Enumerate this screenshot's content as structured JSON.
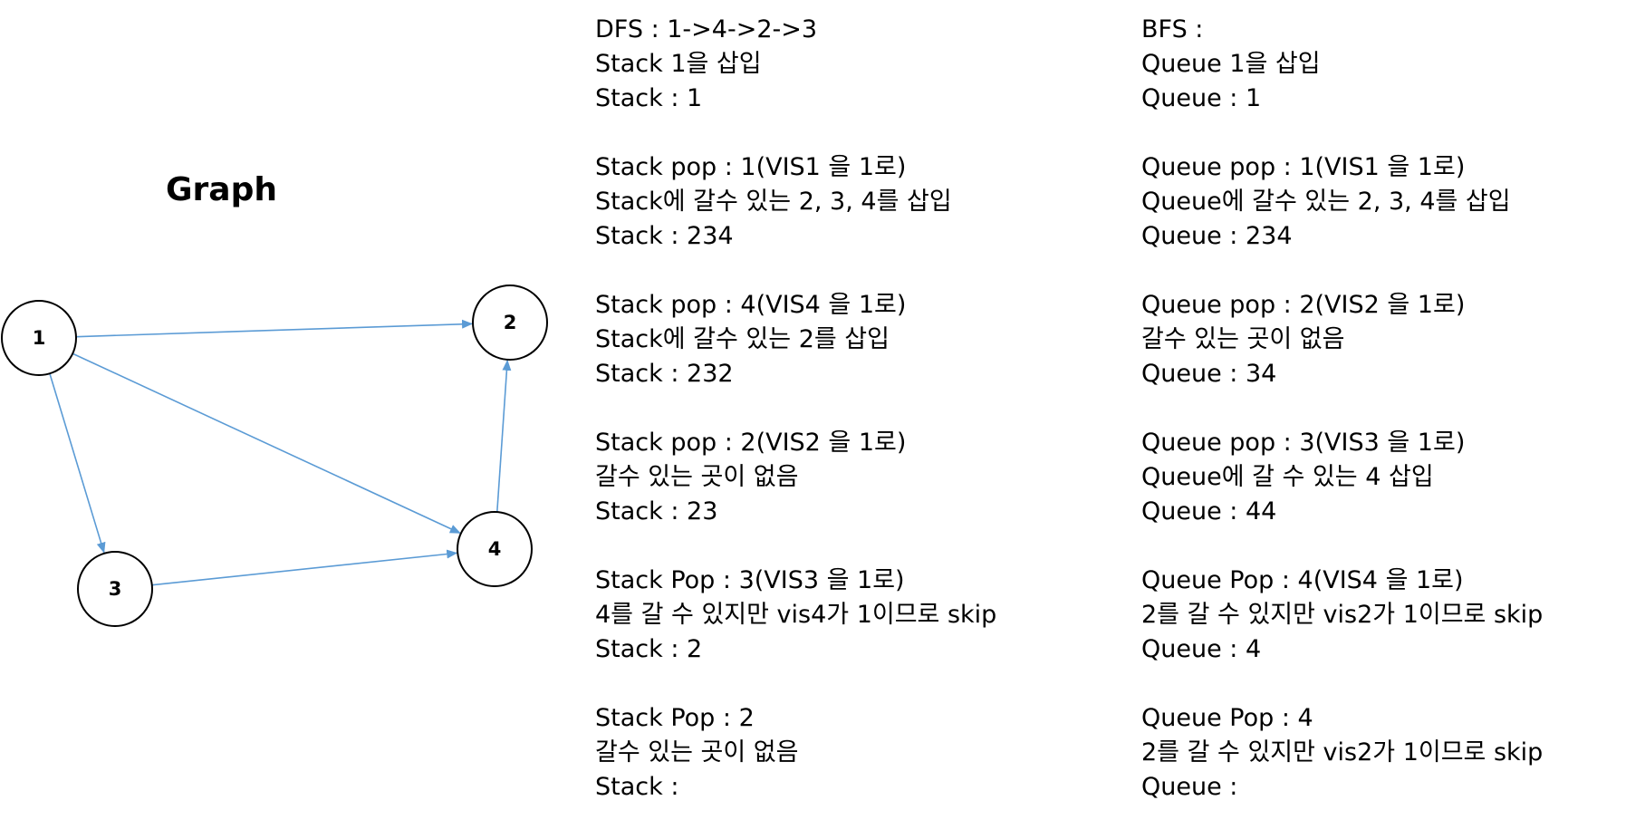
{
  "graph": {
    "title": "Graph",
    "edge_color": "#5b9bd5",
    "nodes": [
      "1",
      "2",
      "3",
      "4"
    ],
    "edges": [
      {
        "from": "1",
        "to": "2"
      },
      {
        "from": "1",
        "to": "3"
      },
      {
        "from": "1",
        "to": "4"
      },
      {
        "from": "3",
        "to": "4"
      },
      {
        "from": "4",
        "to": "2"
      }
    ]
  },
  "dfs": {
    "blocks": [
      [
        "DFS : 1->4->2->3",
        "Stack 1을 삽입",
        "Stack : 1"
      ],
      [
        "Stack pop : 1(VIS1 을 1로)",
        "Stack에 갈수 있는 2, 3, 4를 삽입",
        "Stack : 234"
      ],
      [
        "Stack pop : 4(VIS4 을 1로)",
        "Stack에 갈수 있는 2를 삽입",
        "Stack : 232"
      ],
      [
        "Stack pop : 2(VIS2 을 1로)",
        "갈수 있는 곳이 없음",
        "Stack : 23"
      ],
      [
        "Stack Pop : 3(VIS3 을 1로)",
        "4를 갈 수 있지만 vis4가 1이므로 skip",
        "Stack : 2"
      ],
      [
        "Stack Pop : 2",
        "갈수 있는 곳이 없음",
        "Stack :"
      ]
    ]
  },
  "bfs": {
    "blocks": [
      [
        "BFS :",
        "Queue 1을 삽입",
        "Queue : 1"
      ],
      [
        "Queue pop : 1(VIS1 을 1로)",
        "Queue에 갈수 있는 2, 3, 4를 삽입",
        "Queue : 234"
      ],
      [
        "Queue pop : 2(VIS2 을 1로)",
        "갈수 있는 곳이 없음",
        "Queue : 34"
      ],
      [
        "Queue pop : 3(VIS3 을 1로)",
        "Queue에 갈 수 있는 4 삽입",
        "Queue : 44"
      ],
      [
        "Queue Pop : 4(VIS4 을 1로)",
        "2를 갈 수 있지만 vis2가 1이므로 skip",
        "Queue : 4"
      ],
      [
        "Queue Pop : 4",
        "2를 갈 수 있지만 vis2가 1이므로 skip",
        "Queue :"
      ]
    ]
  }
}
